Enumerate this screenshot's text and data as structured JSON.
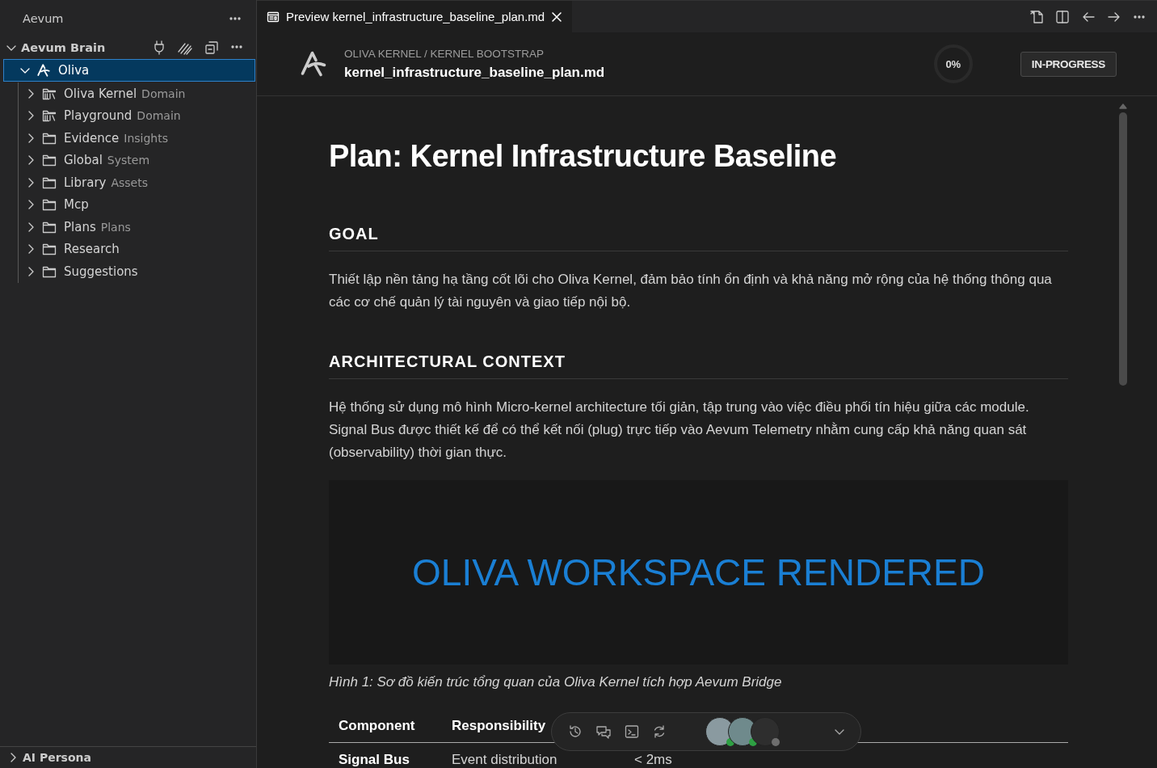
{
  "sidebar": {
    "title": "Aevum",
    "tree": {
      "title": "Aevum Brain",
      "expanded": true,
      "items": [
        {
          "label": "Oliva",
          "selected": true,
          "expanded": true,
          "children": [
            {
              "label": "Oliva Kernel",
              "description": "Domain",
              "kind": "domain",
              "expanded": false,
              "selected": false
            },
            {
              "label": "Playground",
              "description": "Domain",
              "kind": "domain",
              "expanded": false,
              "selected": false
            },
            {
              "label": "Evidence",
              "description": "Insights",
              "kind": "folder",
              "expanded": false,
              "selected": false
            },
            {
              "label": "Global",
              "description": "System",
              "kind": "folder",
              "expanded": false,
              "selected": false
            },
            {
              "label": "Library",
              "description": "Assets",
              "kind": "folder",
              "expanded": false,
              "selected": false
            },
            {
              "label": "Mcp",
              "kind": "folder",
              "expanded": false,
              "selected": false
            },
            {
              "label": "Plans",
              "description": "Plans",
              "kind": "folder",
              "expanded": false,
              "selected": false
            },
            {
              "label": "Research",
              "kind": "folder",
              "expanded": false,
              "selected": false
            },
            {
              "label": "Suggestions",
              "kind": "folder",
              "expanded": false,
              "selected": false
            }
          ]
        }
      ]
    },
    "footer": {
      "title": "AI Persona",
      "expanded": false
    }
  },
  "tab": {
    "title": "Preview kernel_infrastructure_baseline_plan.md"
  },
  "header": {
    "breadcrumb": "OLIVA KERNEL / KERNEL BOOTSTRAP",
    "filename": "kernel_infrastructure_baseline_plan.md",
    "progress": "0%",
    "level": 0,
    "status": "IN-PROGRESS"
  },
  "document": {
    "title": "Plan: Kernel Infrastructure Baseline",
    "sections": [
      {
        "heading": "GOAL",
        "text": "Thiết lập nền tảng hạ tầng cốt lõi cho Oliva Kernel, đảm bảo tính ổn định và khả năng mở rộng của hệ thống thông qua các cơ chế quản lý tài nguyên và giao tiếp nội bộ."
      },
      {
        "heading": "ARCHITECTURAL CONTEXT",
        "text": "Hệ thống sử dụng mô hình Micro-kernel architecture tối giản, tập trung vào việc điều phối tín hiệu giữa các module. Signal Bus được thiết kế để có thể kết nối (plug) trực tiếp vào Aevum Telemetry nhằm cung cấp khả năng quan sát (observability) thời gian thực."
      }
    ],
    "figure": {
      "text": "OLIVA WORKSPACE RENDERED",
      "caption": "Hình 1: Sơ đồ kiến trúc tổng quan của Oliva Kernel tích hợp Aevum Bridge"
    },
    "table": {
      "columns": [
        "Component",
        "Responsibility"
      ],
      "rows": [
        [
          "Signal Bus",
          "Event distribution",
          "< 2ms"
        ]
      ]
    }
  },
  "toolbar": {
    "avatars": [
      {
        "color": "#2ea043"
      },
      {
        "color": "#2ea043"
      },
      {
        "color": "#6e6e6e"
      }
    ]
  }
}
